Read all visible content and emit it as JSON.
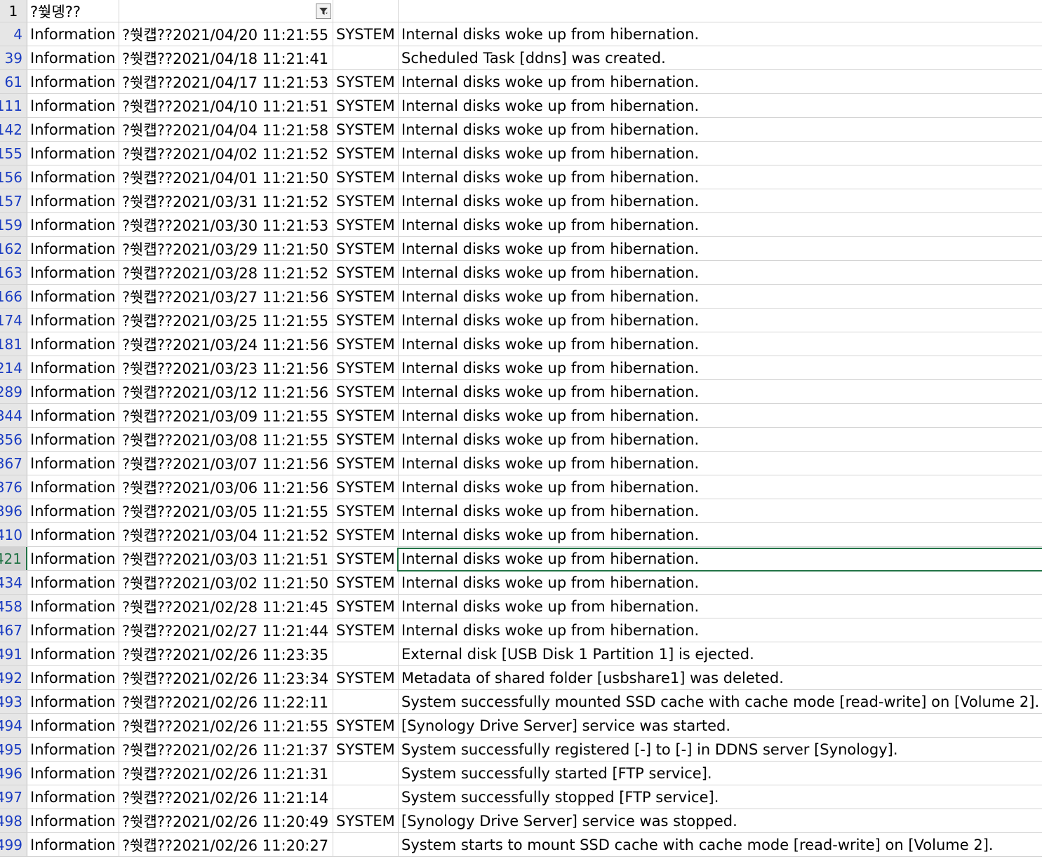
{
  "header": {
    "row_number": "1",
    "col1_title": "?쒖뎽??",
    "filter_icon": "filter-funnel-icon"
  },
  "active_row": "421",
  "rows": [
    {
      "n": "4",
      "level": "Information",
      "time": "?쒓컙??2021/04/20 11:21:55",
      "user": "SYSTEM",
      "event": "Internal disks woke up from hibernation."
    },
    {
      "n": "39",
      "level": "Information",
      "time": "?쒓컙??2021/04/18 11:21:41",
      "user": "",
      "event": "Scheduled Task [ddns] was created."
    },
    {
      "n": "61",
      "level": "Information",
      "time": "?쒓컙??2021/04/17 11:21:53",
      "user": "SYSTEM",
      "event": "Internal disks woke up from hibernation."
    },
    {
      "n": "111",
      "level": "Information",
      "time": "?쒓컙??2021/04/10 11:21:51",
      "user": "SYSTEM",
      "event": "Internal disks woke up from hibernation."
    },
    {
      "n": "142",
      "level": "Information",
      "time": "?쒓컙??2021/04/04 11:21:58",
      "user": "SYSTEM",
      "event": "Internal disks woke up from hibernation."
    },
    {
      "n": "155",
      "level": "Information",
      "time": "?쒓컙??2021/04/02 11:21:52",
      "user": "SYSTEM",
      "event": "Internal disks woke up from hibernation."
    },
    {
      "n": "156",
      "level": "Information",
      "time": "?쒓컙??2021/04/01 11:21:50",
      "user": "SYSTEM",
      "event": "Internal disks woke up from hibernation."
    },
    {
      "n": "157",
      "level": "Information",
      "time": "?쒓컙??2021/03/31 11:21:52",
      "user": "SYSTEM",
      "event": "Internal disks woke up from hibernation."
    },
    {
      "n": "159",
      "level": "Information",
      "time": "?쒓컙??2021/03/30 11:21:53",
      "user": "SYSTEM",
      "event": "Internal disks woke up from hibernation."
    },
    {
      "n": "162",
      "level": "Information",
      "time": "?쒓컙??2021/03/29 11:21:50",
      "user": "SYSTEM",
      "event": "Internal disks woke up from hibernation."
    },
    {
      "n": "163",
      "level": "Information",
      "time": "?쒓컙??2021/03/28 11:21:52",
      "user": "SYSTEM",
      "event": "Internal disks woke up from hibernation."
    },
    {
      "n": "166",
      "level": "Information",
      "time": "?쒓컙??2021/03/27 11:21:56",
      "user": "SYSTEM",
      "event": "Internal disks woke up from hibernation."
    },
    {
      "n": "174",
      "level": "Information",
      "time": "?쒓컙??2021/03/25 11:21:55",
      "user": "SYSTEM",
      "event": "Internal disks woke up from hibernation."
    },
    {
      "n": "181",
      "level": "Information",
      "time": "?쒓컙??2021/03/24 11:21:56",
      "user": "SYSTEM",
      "event": "Internal disks woke up from hibernation."
    },
    {
      "n": "214",
      "level": "Information",
      "time": "?쒓컙??2021/03/23 11:21:56",
      "user": "SYSTEM",
      "event": "Internal disks woke up from hibernation."
    },
    {
      "n": "289",
      "level": "Information",
      "time": "?쒓컙??2021/03/12 11:21:56",
      "user": "SYSTEM",
      "event": "Internal disks woke up from hibernation."
    },
    {
      "n": "344",
      "level": "Information",
      "time": "?쒓컙??2021/03/09 11:21:55",
      "user": "SYSTEM",
      "event": "Internal disks woke up from hibernation."
    },
    {
      "n": "356",
      "level": "Information",
      "time": "?쒓컙??2021/03/08 11:21:55",
      "user": "SYSTEM",
      "event": "Internal disks woke up from hibernation."
    },
    {
      "n": "367",
      "level": "Information",
      "time": "?쒓컙??2021/03/07 11:21:56",
      "user": "SYSTEM",
      "event": "Internal disks woke up from hibernation."
    },
    {
      "n": "376",
      "level": "Information",
      "time": "?쒓컙??2021/03/06 11:21:56",
      "user": "SYSTEM",
      "event": "Internal disks woke up from hibernation."
    },
    {
      "n": "396",
      "level": "Information",
      "time": "?쒓컙??2021/03/05 11:21:55",
      "user": "SYSTEM",
      "event": "Internal disks woke up from hibernation."
    },
    {
      "n": "410",
      "level": "Information",
      "time": "?쒓컙??2021/03/04 11:21:52",
      "user": "SYSTEM",
      "event": "Internal disks woke up from hibernation."
    },
    {
      "n": "421",
      "level": "Information",
      "time": "?쒓컙??2021/03/03 11:21:51",
      "user": "SYSTEM",
      "event": "Internal disks woke up from hibernation."
    },
    {
      "n": "434",
      "level": "Information",
      "time": "?쒓컙??2021/03/02 11:21:50",
      "user": "SYSTEM",
      "event": "Internal disks woke up from hibernation."
    },
    {
      "n": "458",
      "level": "Information",
      "time": "?쒓컙??2021/02/28 11:21:45",
      "user": "SYSTEM",
      "event": "Internal disks woke up from hibernation."
    },
    {
      "n": "467",
      "level": "Information",
      "time": "?쒓컙??2021/02/27 11:21:44",
      "user": "SYSTEM",
      "event": "Internal disks woke up from hibernation."
    },
    {
      "n": "491",
      "level": "Information",
      "time": "?쒓컙??2021/02/26 11:23:35",
      "user": "",
      "event": "External disk [USB Disk 1 Partition 1] is ejected."
    },
    {
      "n": "492",
      "level": "Information",
      "time": "?쒓컙??2021/02/26 11:23:34",
      "user": "SYSTEM",
      "event": "Metadata of shared folder [usbshare1] was deleted."
    },
    {
      "n": "493",
      "level": "Information",
      "time": "?쒓컙??2021/02/26 11:22:11",
      "user": "",
      "event": "System successfully mounted SSD cache with cache mode [read-write] on [Volume 2]."
    },
    {
      "n": "494",
      "level": "Information",
      "time": "?쒓컙??2021/02/26 11:21:55",
      "user": "SYSTEM",
      "event": "[Synology Drive Server] service was started."
    },
    {
      "n": "495",
      "level": "Information",
      "time": "?쒓컙??2021/02/26 11:21:37",
      "user": "SYSTEM",
      "event": "System successfully registered [-] to [-] in DDNS server [Synology]."
    },
    {
      "n": "496",
      "level": "Information",
      "time": "?쒓컙??2021/02/26 11:21:31",
      "user": "",
      "event": "System successfully started [FTP service]."
    },
    {
      "n": "497",
      "level": "Information",
      "time": "?쒓컙??2021/02/26 11:21:14",
      "user": "",
      "event": "System successfully stopped [FTP service]."
    },
    {
      "n": "498",
      "level": "Information",
      "time": "?쒓컙??2021/02/26 11:20:49",
      "user": "SYSTEM",
      "event": "[Synology Drive Server] service was stopped."
    },
    {
      "n": "499",
      "level": "Information",
      "time": "?쒓컙??2021/02/26 11:20:27",
      "user": "",
      "event": "System starts to mount SSD cache with cache mode [read-write] on [Volume 2]."
    }
  ]
}
